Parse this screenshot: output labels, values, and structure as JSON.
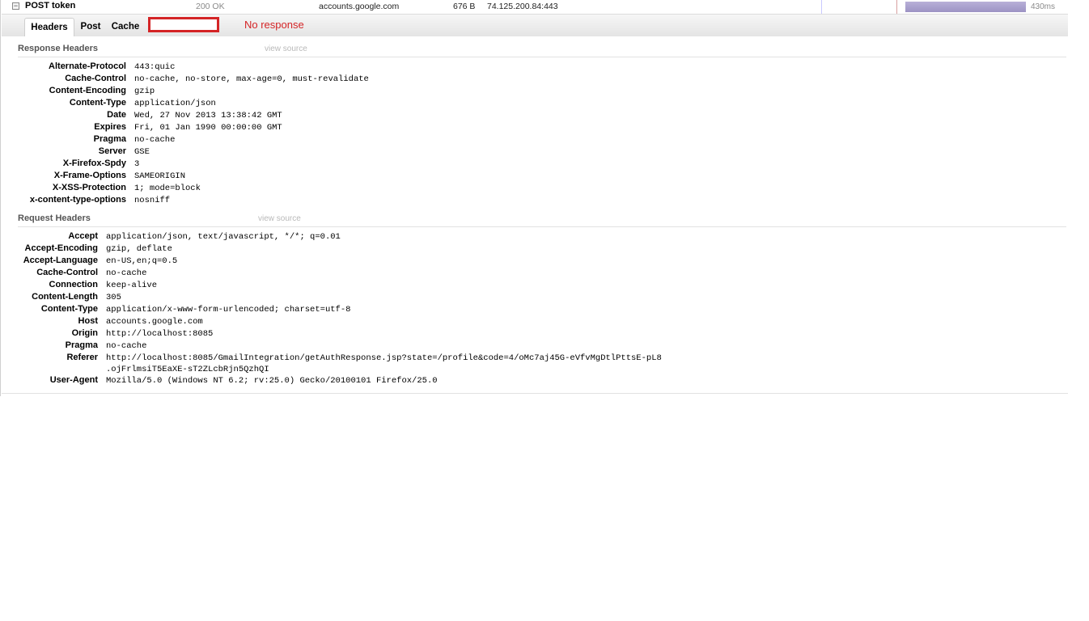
{
  "request": {
    "toggle_glyph": "−",
    "method_url": "POST token",
    "status": "200 OK",
    "domain": "accounts.google.com",
    "size": "676 B",
    "remote_ip": "74.125.200.84:443",
    "timing": "430ms"
  },
  "tabs": {
    "headers": "Headers",
    "post": "Post",
    "cache": "Cache",
    "no_response": "No response"
  },
  "response_headers": {
    "title": "Response Headers",
    "view_source": "view source",
    "rows": [
      {
        "name": "Alternate-Protocol",
        "value": "443:quic"
      },
      {
        "name": "Cache-Control",
        "value": "no-cache, no-store, max-age=0, must-revalidate"
      },
      {
        "name": "Content-Encoding",
        "value": "gzip"
      },
      {
        "name": "Content-Type",
        "value": "application/json"
      },
      {
        "name": "Date",
        "value": "Wed, 27 Nov 2013 13:38:42 GMT"
      },
      {
        "name": "Expires",
        "value": "Fri, 01 Jan 1990 00:00:00 GMT"
      },
      {
        "name": "Pragma",
        "value": "no-cache"
      },
      {
        "name": "Server",
        "value": "GSE"
      },
      {
        "name": "X-Firefox-Spdy",
        "value": "3"
      },
      {
        "name": "X-Frame-Options",
        "value": "SAMEORIGIN"
      },
      {
        "name": "X-XSS-Protection",
        "value": "1; mode=block"
      },
      {
        "name": "x-content-type-options",
        "value": "nosniff"
      }
    ]
  },
  "request_headers": {
    "title": "Request Headers",
    "view_source": "view source",
    "rows": [
      {
        "name": "Accept",
        "value": "application/json, text/javascript, */*; q=0.01"
      },
      {
        "name": "Accept-Encoding",
        "value": "gzip, deflate"
      },
      {
        "name": "Accept-Language",
        "value": "en-US,en;q=0.5"
      },
      {
        "name": "Cache-Control",
        "value": "no-cache"
      },
      {
        "name": "Connection",
        "value": "keep-alive"
      },
      {
        "name": "Content-Length",
        "value": "305"
      },
      {
        "name": "Content-Type",
        "value": "application/x-www-form-urlencoded; charset=utf-8"
      },
      {
        "name": "Host",
        "value": "accounts.google.com"
      },
      {
        "name": "Origin",
        "value": "http://localhost:8085"
      },
      {
        "name": "Pragma",
        "value": "no-cache"
      },
      {
        "name": "Referer",
        "value": "http://localhost:8085/GmailIntegration/getAuthResponse.jsp?state=/profile&code=4/oMc7aj45G-eVfvMgDtlPttsE-pL8",
        "value2": ".ojFrlmsiT5EaXE-sT2ZLcbRjn5QzhQI"
      },
      {
        "name": "User-Agent",
        "value": "Mozilla/5.0 (Windows NT 6.2; rv:25.0) Gecko/20100101 Firefox/25.0"
      }
    ]
  },
  "colors": {
    "highlight": "#d42426",
    "timing_bar": "#9d93c4"
  }
}
